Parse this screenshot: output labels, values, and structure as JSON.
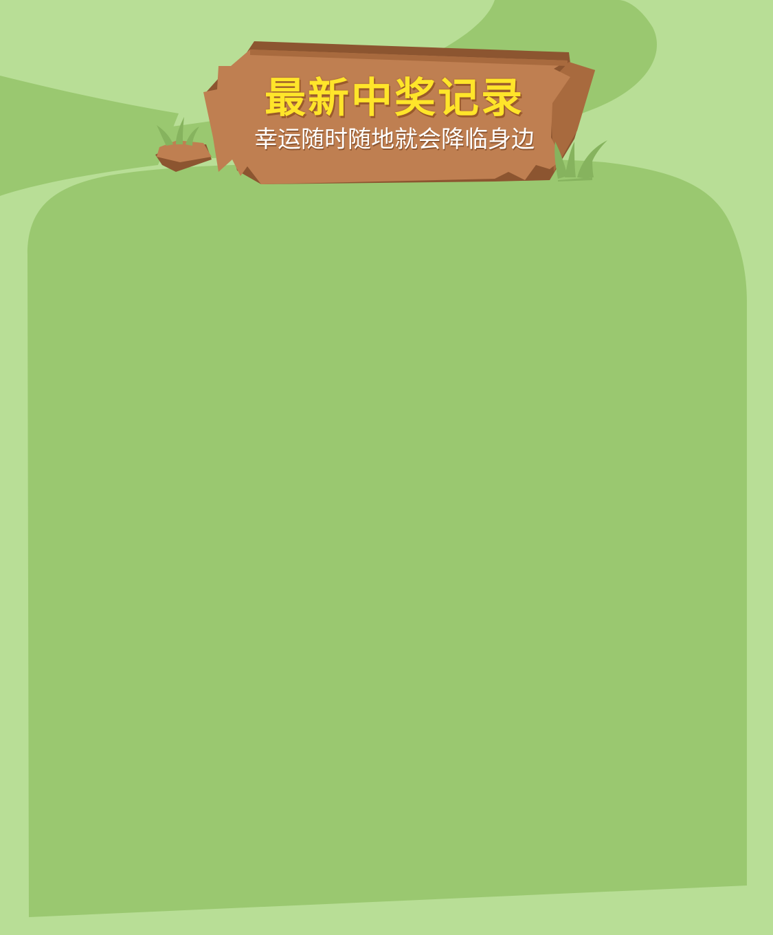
{
  "sign": {
    "title": "最新中奖记录",
    "subtitle": "幸运随时随地就会降临身边"
  },
  "colors": {
    "background": "#b8de96",
    "hill": "#9ac870",
    "panel": "#9ac870",
    "wood_face": "#bf7f51",
    "wood_dark": "#8c5530",
    "wood_edge": "#a86a3e",
    "grass_blade": "#86b35e",
    "title_text": "#ffe52a",
    "subtitle_text": "#ffffff"
  },
  "records": []
}
